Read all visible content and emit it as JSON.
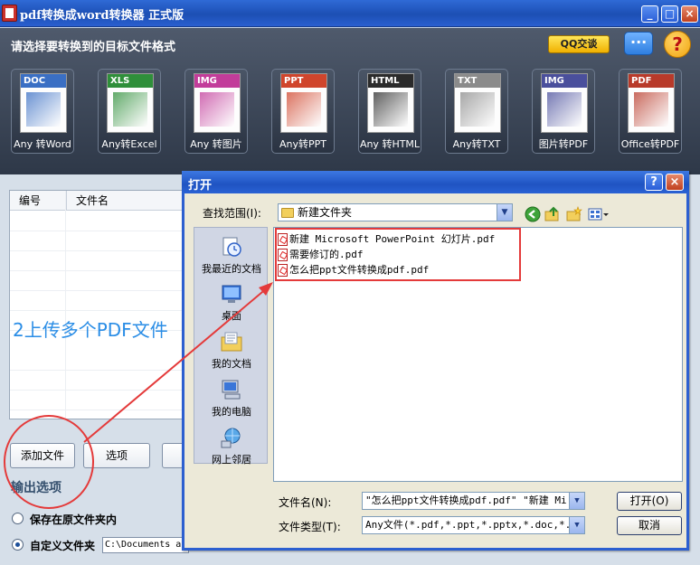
{
  "window": {
    "title": "pdf转换成word转换器 正式版",
    "controls": {
      "minimize": "_",
      "maximize": "□",
      "close": "×"
    }
  },
  "header": {
    "prompt": "请选择要转换到的目标文件格式",
    "qq_button": "QQ交谈",
    "chat_icon": "chat-bubble-icon",
    "help_icon": "?"
  },
  "formats": [
    {
      "tag": "DOC",
      "label": "Any 转Word",
      "color": "#3a6fc4",
      "icon": "word-doc-icon"
    },
    {
      "tag": "XLS",
      "label": "Any转Excel",
      "color": "#2f8f3a",
      "icon": "excel-doc-icon"
    },
    {
      "tag": "IMG",
      "label": "Any 转图片",
      "color": "#c23c9a",
      "icon": "image-doc-icon"
    },
    {
      "tag": "PPT",
      "label": "Any转PPT",
      "color": "#d0452c",
      "icon": "ppt-doc-icon"
    },
    {
      "tag": "HTML",
      "label": "Any 转HTML",
      "color": "#2b2b2b",
      "icon": "html-doc-icon"
    },
    {
      "tag": "TXT",
      "label": "Any转TXT",
      "color": "#8b8b8b",
      "icon": "txt-doc-icon"
    },
    {
      "tag": "IMG",
      "label": "图片转PDF",
      "color": "#4a4f9c",
      "icon": "image-to-pdf-icon"
    },
    {
      "tag": "PDF",
      "label": "Office转PDF",
      "color": "#b83a2a",
      "icon": "office-to-pdf-icon"
    }
  ],
  "file_table": {
    "columns": [
      "编号",
      "文件名"
    ],
    "rows": []
  },
  "annotation": "2上传多个PDF文件",
  "buttons": {
    "add_file": "添加文件",
    "options": "选项"
  },
  "output": {
    "title": "输出选项",
    "option_original": "保存在原文件夹内",
    "option_custom": "自定义文件夹",
    "custom_path": "C:\\Documents a",
    "selected": "custom"
  },
  "dialog": {
    "title": "打开",
    "help": "?",
    "close": "×",
    "look_in_label": "查找范围(I):",
    "look_in_value": "新建文件夹",
    "places": [
      "我最近的文档",
      "桌面",
      "我的文档",
      "我的电脑",
      "网上邻居"
    ],
    "files": [
      "新建 Microsoft PowerPoint 幻灯片.pdf",
      "需要修订的.pdf",
      "怎么把ppt文件转换成pdf.pdf"
    ],
    "filename_label": "文件名(N):",
    "filename_value": "\"怎么把ppt文件转换成pdf.pdf\" \"新建 Mi",
    "filetype_label": "文件类型(T):",
    "filetype_value": "Any文件(*.pdf,*.ppt,*.pptx,*.doc,*.do",
    "open_button": "打开(O)",
    "cancel_button": "取消"
  }
}
